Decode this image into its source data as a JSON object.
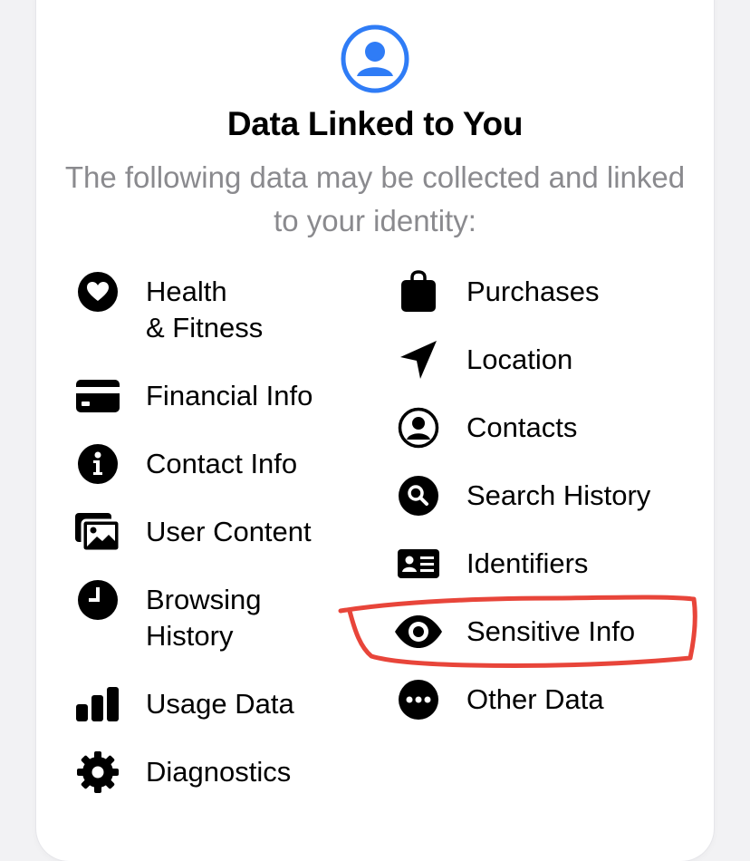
{
  "header": {
    "icon": "person-circle-icon",
    "accent_color": "#2f7cf6",
    "title": "Data Linked to You",
    "subtitle": "The following data may be collected and linked to your identity:"
  },
  "left_column": [
    {
      "icon": "heart-icon",
      "label_line1": "Health",
      "label_line2": "& Fitness"
    },
    {
      "icon": "credit-card-icon",
      "label": "Financial Info"
    },
    {
      "icon": "info-icon",
      "label": "Contact Info"
    },
    {
      "icon": "photos-icon",
      "label": "User Content"
    },
    {
      "icon": "clock-icon",
      "label_line1": "Browsing",
      "label_line2": "History"
    },
    {
      "icon": "bar-chart-icon",
      "label": "Usage Data"
    },
    {
      "icon": "gear-icon",
      "label": "Diagnostics"
    }
  ],
  "right_column": [
    {
      "icon": "shopping-bag-icon",
      "label": "Purchases"
    },
    {
      "icon": "location-arrow-icon",
      "label": "Location"
    },
    {
      "icon": "person-circle-icon",
      "label": "Contacts"
    },
    {
      "icon": "magnifier-icon",
      "label": "Search History"
    },
    {
      "icon": "id-card-icon",
      "label": "Identifiers"
    },
    {
      "icon": "eye-icon",
      "label": "Sensitive Info"
    },
    {
      "icon": "ellipsis-icon",
      "label": "Other Data"
    }
  ],
  "annotation": {
    "color": "#e8453a"
  }
}
